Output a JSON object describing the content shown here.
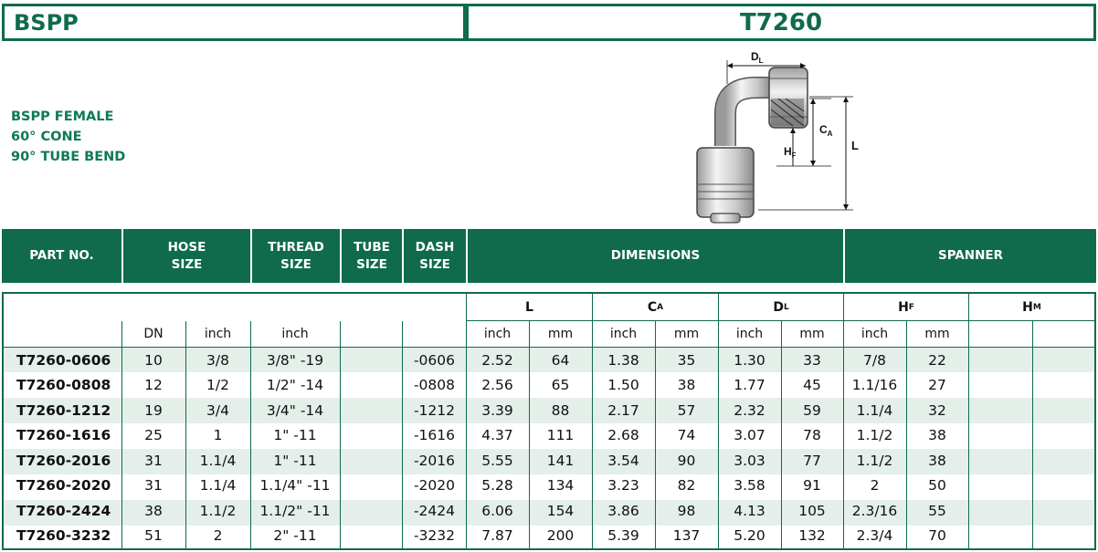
{
  "titles": {
    "left": "BSPP",
    "right": "T7260"
  },
  "description": [
    "BSPP FEMALE",
    "60° CONE",
    "90° TUBE BEND"
  ],
  "diagram": {
    "labels": {
      "dl": "D",
      "dl_sub": "L",
      "ca": "C",
      "ca_sub": "A",
      "hf": "H",
      "hf_sub": "F",
      "l": "L"
    }
  },
  "header": {
    "part_no": "PART NO.",
    "hose_size": [
      "HOSE",
      "SIZE"
    ],
    "thread_size": [
      "THREAD",
      "SIZE"
    ],
    "tube_size": [
      "TUBE",
      "SIZE"
    ],
    "dash_size": [
      "DASH",
      "SIZE"
    ],
    "dimensions": "DIMENSIONS",
    "spanner": "SPANNER"
  },
  "groups": {
    "l": {
      "main": "L",
      "sub": ""
    },
    "ca": {
      "main": "C",
      "sub": "A"
    },
    "dl": {
      "main": "D",
      "sub": "L"
    },
    "hf": {
      "main": "H",
      "sub": "F"
    },
    "hm": {
      "main": "H",
      "sub": "M"
    }
  },
  "units": {
    "dn": "DN",
    "hose_inch": "inch",
    "thread_inch": "inch",
    "l_inch": "inch",
    "l_mm": "mm",
    "ca_inch": "inch",
    "ca_mm": "mm",
    "dl_inch": "inch",
    "dl_mm": "mm",
    "hf_inch": "inch",
    "hf_mm": "mm"
  },
  "rows": [
    {
      "part": "T7260-0606",
      "dn": "10",
      "inch": "3/8",
      "thread": "3/8\" -19",
      "tube": "",
      "dash": "-0606",
      "l_in": "2.52",
      "l_mm": "64",
      "ca_in": "1.38",
      "ca_mm": "35",
      "dl_in": "1.30",
      "dl_mm": "33",
      "hf_in": "7/8",
      "hf_mm": "22",
      "hm_a": "",
      "hm_b": ""
    },
    {
      "part": "T7260-0808",
      "dn": "12",
      "inch": "1/2",
      "thread": "1/2\" -14",
      "tube": "",
      "dash": "-0808",
      "l_in": "2.56",
      "l_mm": "65",
      "ca_in": "1.50",
      "ca_mm": "38",
      "dl_in": "1.77",
      "dl_mm": "45",
      "hf_in": "1.1/16",
      "hf_mm": "27",
      "hm_a": "",
      "hm_b": ""
    },
    {
      "part": "T7260-1212",
      "dn": "19",
      "inch": "3/4",
      "thread": "3/4\" -14",
      "tube": "",
      "dash": "-1212",
      "l_in": "3.39",
      "l_mm": "88",
      "ca_in": "2.17",
      "ca_mm": "57",
      "dl_in": "2.32",
      "dl_mm": "59",
      "hf_in": "1.1/4",
      "hf_mm": "32",
      "hm_a": "",
      "hm_b": ""
    },
    {
      "part": "T7260-1616",
      "dn": "25",
      "inch": "1",
      "thread": "1\" -11",
      "tube": "",
      "dash": "-1616",
      "l_in": "4.37",
      "l_mm": "111",
      "ca_in": "2.68",
      "ca_mm": "74",
      "dl_in": "3.07",
      "dl_mm": "78",
      "hf_in": "1.1/2",
      "hf_mm": "38",
      "hm_a": "",
      "hm_b": ""
    },
    {
      "part": "T7260-2016",
      "dn": "31",
      "inch": "1.1/4",
      "thread": "1\" -11",
      "tube": "",
      "dash": "-2016",
      "l_in": "5.55",
      "l_mm": "141",
      "ca_in": "3.54",
      "ca_mm": "90",
      "dl_in": "3.03",
      "dl_mm": "77",
      "hf_in": "1.1/2",
      "hf_mm": "38",
      "hm_a": "",
      "hm_b": ""
    },
    {
      "part": "T7260-2020",
      "dn": "31",
      "inch": "1.1/4",
      "thread": "1.1/4\" -11",
      "tube": "",
      "dash": "-2020",
      "l_in": "5.28",
      "l_mm": "134",
      "ca_in": "3.23",
      "ca_mm": "82",
      "dl_in": "3.58",
      "dl_mm": "91",
      "hf_in": "2",
      "hf_mm": "50",
      "hm_a": "",
      "hm_b": ""
    },
    {
      "part": "T7260-2424",
      "dn": "38",
      "inch": "1.1/2",
      "thread": "1.1/2\" -11",
      "tube": "",
      "dash": "-2424",
      "l_in": "6.06",
      "l_mm": "154",
      "ca_in": "3.86",
      "ca_mm": "98",
      "dl_in": "4.13",
      "dl_mm": "105",
      "hf_in": "2.3/16",
      "hf_mm": "55",
      "hm_a": "",
      "hm_b": ""
    },
    {
      "part": "T7260-3232",
      "dn": "51",
      "inch": "2",
      "thread": "2\" -11",
      "tube": "",
      "dash": "-3232",
      "l_in": "7.87",
      "l_mm": "200",
      "ca_in": "5.39",
      "ca_mm": "137",
      "dl_in": "5.20",
      "dl_mm": "132",
      "hf_in": "2.3/4",
      "hf_mm": "70",
      "hm_a": "",
      "hm_b": ""
    }
  ],
  "colors": {
    "brand_green": "#0f6b4c",
    "text_green": "#0f7a52",
    "row_shade": "#e4efe9"
  }
}
